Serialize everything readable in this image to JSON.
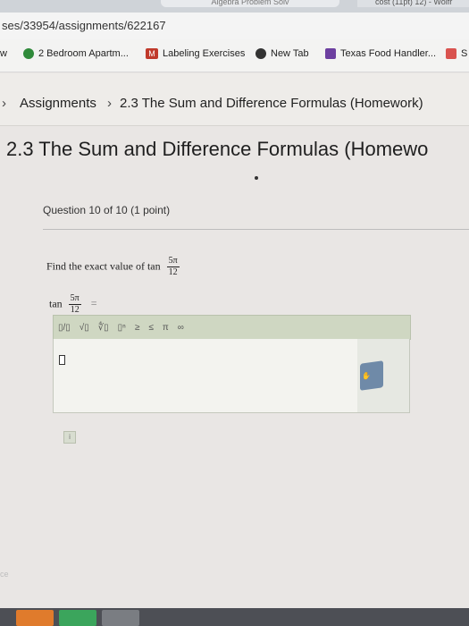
{
  "browser": {
    "url_text": "ses/33954/assignments/622167",
    "tab_text": "Algebra Problem Solv",
    "tab2_text": "cost (11pt) 12) - Wolfr"
  },
  "bookmarks": [
    {
      "label": "w",
      "icon": "unknown-icon",
      "color": "#8a8a8a"
    },
    {
      "label": "2 Bedroom Apartm...",
      "icon": "flower-icon",
      "color": "#2f8a3a"
    },
    {
      "label": "Labeling Exercises",
      "icon": "m-logo-icon",
      "color": "#c0392b"
    },
    {
      "label": "New Tab",
      "icon": "chrome-icon",
      "color": "#333333"
    },
    {
      "label": "Texas Food Handler...",
      "icon": "flag-icon",
      "color": "#6c3fa0"
    },
    {
      "label": "S",
      "icon": "mail-icon",
      "color": "#d9534f"
    }
  ],
  "breadcrumb": {
    "root": "Assignments",
    "separator": "›",
    "current": "2.3 The Sum and Difference Formulas (Homework)"
  },
  "page_title": "2.3 The Sum and Difference Formulas (Homewo",
  "question": {
    "header": "Question 10 of 10 (1 point)",
    "prompt_prefix": "Find the exact value of tan",
    "frac_num": "5π",
    "frac_den": "12",
    "answer_lhs": "tan",
    "answer_eq": "="
  },
  "toolbar": {
    "buttons": [
      "▯/▯",
      "√▯",
      "∜▯",
      "▯ⁿ",
      "≥",
      "≤",
      "π",
      "∞"
    ]
  },
  "answer_box": {
    "cursor": "▯"
  },
  "faint_text": "ce"
}
